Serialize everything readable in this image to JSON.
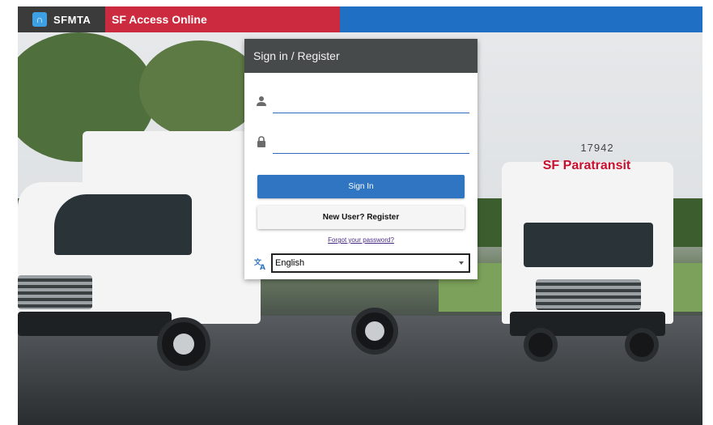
{
  "header": {
    "logo_text": "SFMTA",
    "app_title": "SF Access Online"
  },
  "login": {
    "title": "Sign in / Register",
    "username": {
      "value": "",
      "placeholder": ""
    },
    "password": {
      "value": "",
      "placeholder": ""
    },
    "sign_in_label": "Sign In",
    "register_label": "New User? Register",
    "forgot_label": "Forgot your password?",
    "language": {
      "selected": "English"
    }
  },
  "background": {
    "bus_number": "17942",
    "bus_sign": "SF Paratransit"
  },
  "colors": {
    "header_blue": "#1f6fc5",
    "brand_red": "#cc2b3f",
    "panel_head": "#474a4b",
    "primary_button": "#2f75c1"
  },
  "icons": {
    "user": "user-icon",
    "lock": "lock-icon",
    "translate": "translate-icon",
    "dropdown": "chevron-down-icon"
  }
}
